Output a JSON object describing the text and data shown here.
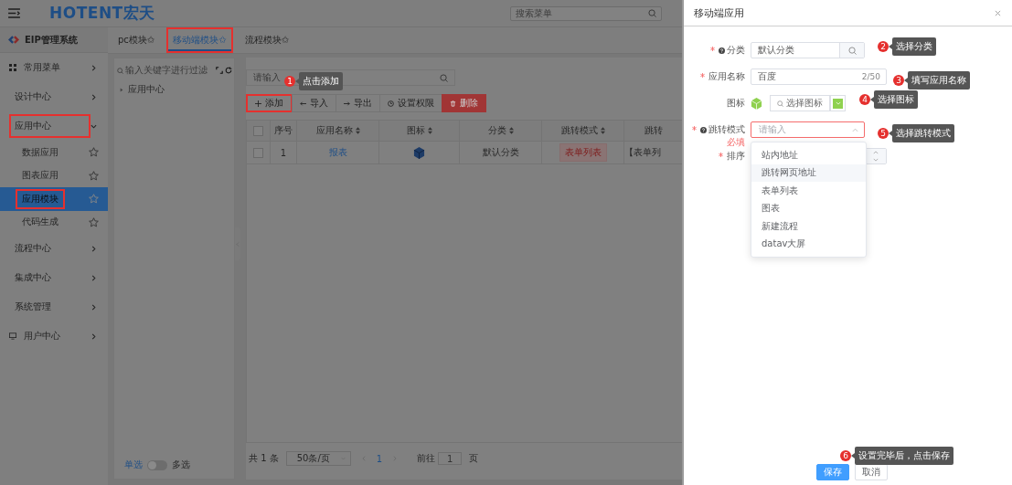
{
  "header": {
    "logo": "HOTENT宏天",
    "search_placeholder": "搜索菜单"
  },
  "sidebar": {
    "title": "EIP管理系统",
    "items": [
      {
        "label": "常用菜单",
        "expanded": false,
        "highlighted": false
      },
      {
        "label": "设计中心",
        "expanded": false,
        "highlighted": false
      },
      {
        "label": "应用中心",
        "expanded": true,
        "highlighted": true,
        "children": [
          {
            "label": "数据应用",
            "selected": false,
            "highlighted": false
          },
          {
            "label": "图表应用",
            "selected": false,
            "highlighted": false
          },
          {
            "label": "应用模块",
            "selected": true,
            "highlighted": true
          },
          {
            "label": "代码生成",
            "selected": false,
            "highlighted": false
          }
        ]
      },
      {
        "label": "流程中心",
        "expanded": false,
        "highlighted": false
      },
      {
        "label": "集成中心",
        "expanded": false,
        "highlighted": false
      },
      {
        "label": "系统管理",
        "expanded": false,
        "highlighted": false
      },
      {
        "label": "用户中心",
        "expanded": false,
        "highlighted": false
      }
    ]
  },
  "tabs": [
    {
      "label": "pc模块✩",
      "selected": false,
      "highlighted": false
    },
    {
      "label": "移动端模块✩",
      "selected": true,
      "highlighted": true
    },
    {
      "label": "流程模块✩",
      "selected": false,
      "highlighted": false
    }
  ],
  "tree": {
    "filter_placeholder": "输入关键字进行过滤",
    "nodes": [
      {
        "label": "应用中心",
        "expanded": false
      }
    ],
    "mode_left": "单选",
    "mode_right": "多选",
    "multi": false
  },
  "list": {
    "search_placeholder": "请输入",
    "toolbar": [
      {
        "label": "添加",
        "kind": "add",
        "highlighted": true
      },
      {
        "label": "导入",
        "kind": "import",
        "highlighted": false
      },
      {
        "label": "导出",
        "kind": "export",
        "highlighted": false
      },
      {
        "label": "设置权限",
        "kind": "permission",
        "highlighted": false
      },
      {
        "label": "删除",
        "kind": "delete",
        "highlighted": false
      }
    ],
    "all_checked": false,
    "columns": [
      "序号",
      "应用名称",
      "图标",
      "分类",
      "跳转模式",
      "跳转"
    ],
    "rows": [
      {
        "checked": false,
        "index": "1",
        "name": "报表",
        "category": "默认分类",
        "mode": "表单列表",
        "target": "【表单列"
      }
    ],
    "pagination": {
      "total": "共 1 条",
      "page_size": "50条/页",
      "current": "1",
      "goto_label": "前往",
      "goto_value": "1",
      "unit": "页"
    }
  },
  "drawer": {
    "title": "移动端应用",
    "fields": [
      {
        "kind": "lookup",
        "label": "分类",
        "required": true,
        "help": true,
        "value": "默认分类"
      },
      {
        "kind": "text",
        "label": "应用名称",
        "required": true,
        "help": false,
        "value": "百度",
        "counter": "2/50"
      },
      {
        "kind": "icon",
        "label": "图标",
        "required": false,
        "help": false,
        "button": "选择图标"
      },
      {
        "kind": "select",
        "label": "跳转模式",
        "required": true,
        "help": true,
        "placeholder": "请输入",
        "error": "必填",
        "open": true
      },
      {
        "kind": "number",
        "label": "排序",
        "required": true,
        "help": false
      }
    ],
    "options": [
      {
        "label": "站内地址",
        "hovered": false
      },
      {
        "label": "跳转网页地址",
        "hovered": true
      },
      {
        "label": "表单列表",
        "hovered": false
      },
      {
        "label": "图表",
        "hovered": false
      },
      {
        "label": "新建流程",
        "hovered": false
      },
      {
        "label": "datav大屏",
        "hovered": false
      }
    ],
    "buttons": [
      {
        "label": "保存",
        "kind": "primary"
      },
      {
        "label": "取消",
        "kind": "default"
      }
    ]
  },
  "callouts": [
    {
      "number": "1",
      "text": "点击添加"
    },
    {
      "number": "2",
      "text": "选择分类"
    },
    {
      "number": "3",
      "text": "填写应用名称"
    },
    {
      "number": "4",
      "text": "选择图标"
    },
    {
      "number": "5",
      "text": "选择跳转模式"
    },
    {
      "number": "6",
      "text": "设置完毕后，点击保存"
    }
  ]
}
